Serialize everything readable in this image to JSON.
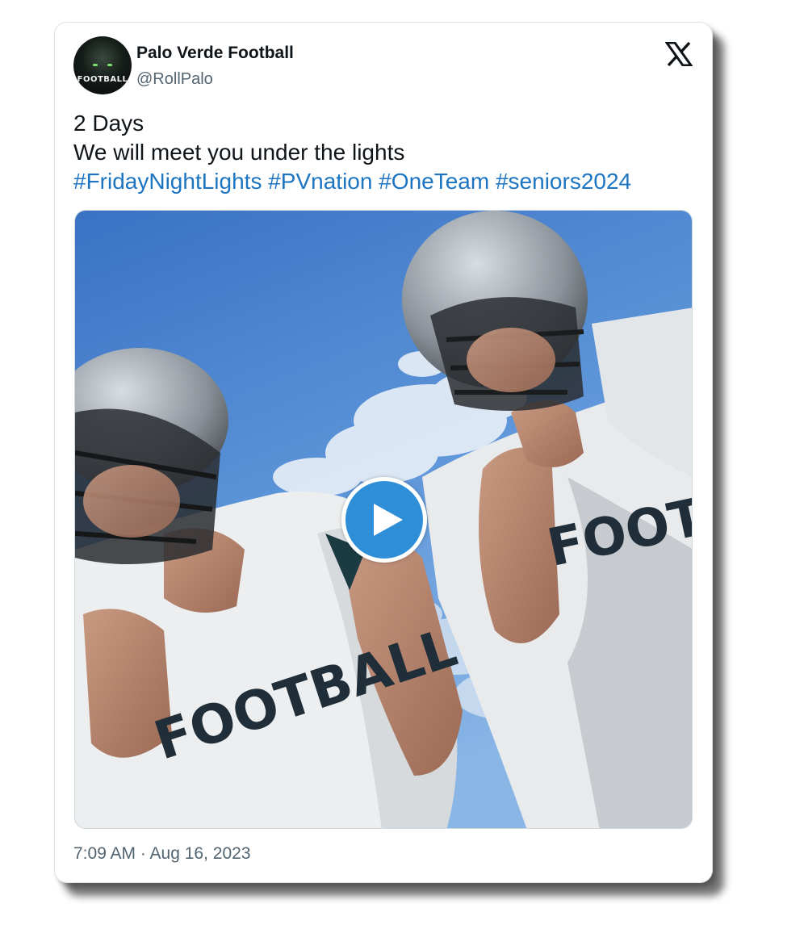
{
  "tweet": {
    "author_name": "Palo Verde Football",
    "author_handle": "@RollPalo",
    "avatar_text": "FOOTBALL",
    "lines": [
      "2 Days",
      "We will meet you under the lights"
    ],
    "hashtags": [
      "#FridayNightLights",
      "#PVnation",
      "#OneTeam",
      "#seniors2024"
    ],
    "timestamp": "7:09 AM · Aug 16, 2023",
    "platform_icon": "x-logo-icon"
  },
  "media": {
    "type": "video",
    "play_icon": "play-icon",
    "jersey_text_left": "FOOTBALL",
    "jersey_text_right": "FOOTBALL"
  },
  "colors": {
    "hashtag": "#1d75c2",
    "play_button": "#2e8fd8",
    "sky": "#4f86cf",
    "secondary_text": "#536471"
  }
}
